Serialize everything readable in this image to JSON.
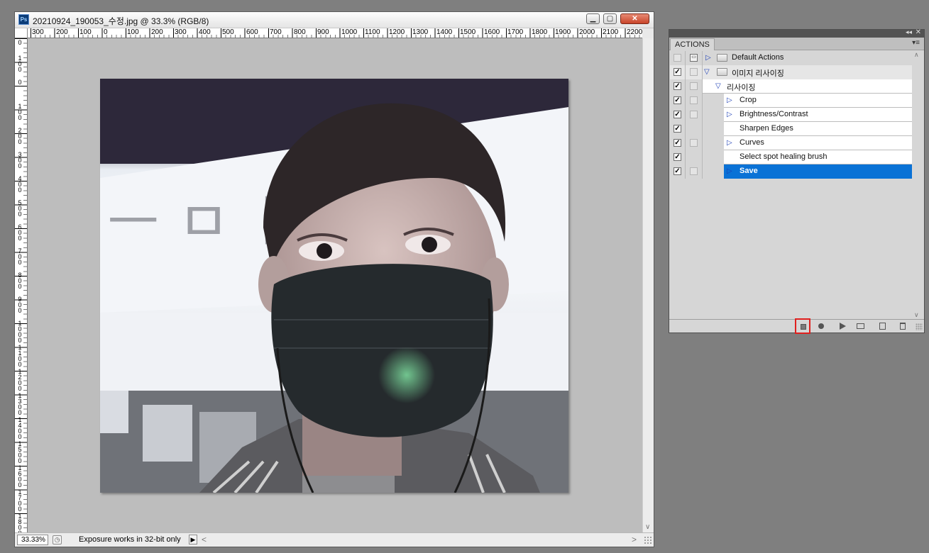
{
  "document": {
    "title": "20210924_190053_수정.jpg @ 33.3% (RGB/8)",
    "app_icon_text": "Ps",
    "window_buttons": {
      "minimize": "▁",
      "maximize": "▢",
      "close": "✕"
    },
    "ruler_h_labels": [
      "300",
      "200",
      "100",
      "0",
      "100",
      "200",
      "300",
      "400",
      "500",
      "600",
      "700",
      "800",
      "900",
      "1000",
      "1100",
      "1200",
      "1300",
      "1400",
      "1500",
      "1600",
      "1700",
      "1800",
      "1900",
      "2000",
      "2100",
      "2200"
    ],
    "ruler_v_labels": [
      "0",
      "100",
      "0",
      "100",
      "200",
      "300",
      "400",
      "500",
      "600",
      "700",
      "800",
      "900",
      "1000",
      "1100",
      "1200",
      "1300",
      "1400",
      "1500",
      "1600",
      "1700",
      "1800"
    ],
    "zoom": "33.33%",
    "status_text": "Exposure works in 32-bit only",
    "status_arrow": "▶",
    "scroll_left": "<",
    "scroll_right": ">",
    "scroll_down": "∨"
  },
  "actions_panel": {
    "tab_label": "ACTIONS",
    "rows": [
      {
        "label": "Default Actions",
        "kind": "set"
      },
      {
        "label": "이미지 리사이징",
        "kind": "set-open"
      },
      {
        "label": "리사이징",
        "kind": "action-open"
      },
      {
        "label": "Crop",
        "kind": "command"
      },
      {
        "label": "Brightness/Contrast",
        "kind": "command"
      },
      {
        "label": "Sharpen Edges",
        "kind": "command"
      },
      {
        "label": "Curves",
        "kind": "command"
      },
      {
        "label": "Select spot healing brush",
        "kind": "command"
      },
      {
        "label": "Save",
        "kind": "command-selected"
      }
    ],
    "highlight_color": "#0a72d6",
    "stop_button_outline": "#e0201e"
  }
}
